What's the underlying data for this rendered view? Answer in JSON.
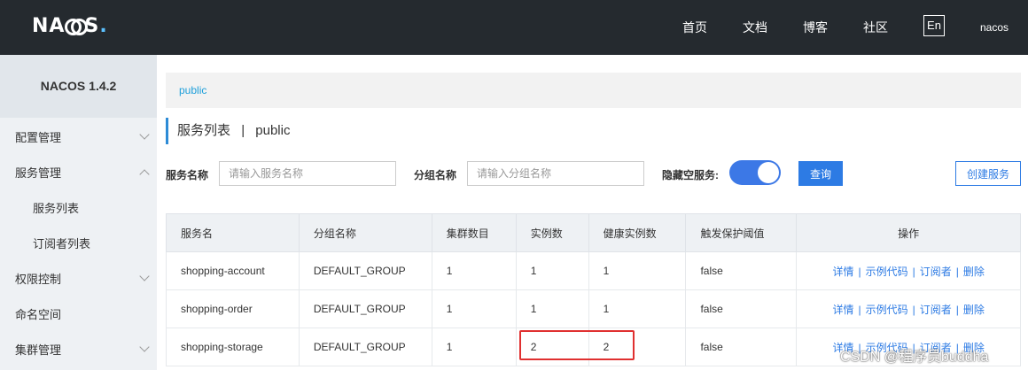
{
  "header": {
    "logo": "NACOS.",
    "nav": [
      "首页",
      "文档",
      "博客",
      "社区"
    ],
    "lang": "En",
    "user": "nacos"
  },
  "sidebar": {
    "title": "NACOS 1.4.2",
    "items": [
      {
        "label": "配置管理"
      },
      {
        "label": "服务管理"
      },
      {
        "label": "服务列表"
      },
      {
        "label": "订阅者列表"
      },
      {
        "label": "权限控制"
      },
      {
        "label": "命名空间"
      },
      {
        "label": "集群管理"
      }
    ]
  },
  "breadcrumb": "public",
  "page": {
    "title": "服务列表",
    "separator": "|",
    "namespace": "public"
  },
  "filters": {
    "service_name_label": "服务名称",
    "service_name_placeholder": "请输入服务名称",
    "group_name_label": "分组名称",
    "group_name_placeholder": "请输入分组名称",
    "hide_empty_label": "隐藏空服务:",
    "hide_empty_on": true,
    "query_label": "查询",
    "create_label": "创建服务"
  },
  "table": {
    "columns": [
      "服务名",
      "分组名称",
      "集群数目",
      "实例数",
      "健康实例数",
      "触发保护阈值",
      "操作"
    ],
    "rows": [
      [
        "shopping-account",
        "DEFAULT_GROUP",
        "1",
        "1",
        "1",
        "false"
      ],
      [
        "shopping-order",
        "DEFAULT_GROUP",
        "1",
        "1",
        "1",
        "false"
      ],
      [
        "shopping-storage",
        "DEFAULT_GROUP",
        "1",
        "2",
        "2",
        "false"
      ]
    ],
    "actions": [
      "详情",
      "示例代码",
      "订阅者",
      "删除"
    ]
  },
  "watermark": "CSDN @程序员buddha",
  "colors": {
    "topbar": "#252a2f",
    "accent": "#2d7be4",
    "highlight": "#e03030"
  }
}
